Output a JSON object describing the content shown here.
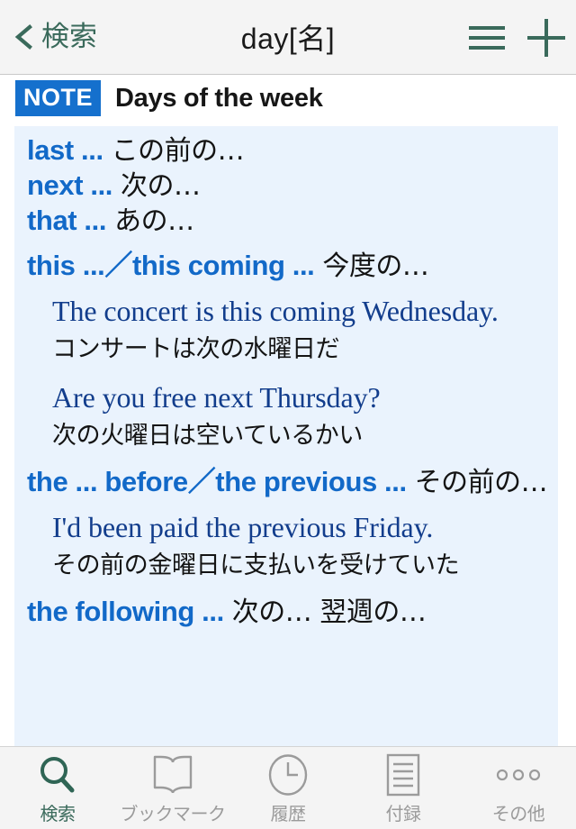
{
  "header": {
    "back_label": "検索",
    "back_icon": "chevron-left-icon",
    "title": "day[名]",
    "menu_icon": "hamburger-menu-icon",
    "add_icon": "plus-icon",
    "accent_color": "#3a6a5b"
  },
  "note": {
    "badge": "NOTE",
    "badge_color": "#1570cd",
    "title": "Days of the week"
  },
  "panel": {
    "background_color": "#eaf3fd",
    "headword_color": "#1269c8",
    "example_color": "#123d8c",
    "entries": [
      {
        "headword": "last ...",
        "gloss": "この前の…"
      },
      {
        "headword": "next ...",
        "gloss": "次の…"
      },
      {
        "headword": "that ...",
        "gloss": "あの…"
      },
      {
        "headword": "this ...／this coming ...",
        "gloss": "今度の…"
      }
    ],
    "examples_1": [
      {
        "en": "The concert is this coming Wednesday.",
        "ja": "コンサートは次の水曜日だ"
      },
      {
        "en": "Are you free next Thursday?",
        "ja": "次の火曜日は空いているかい"
      }
    ],
    "entry_before": {
      "headword": "the ... before／the previous ...",
      "gloss": "その前の…"
    },
    "examples_2": [
      {
        "en": "I'd been paid the previous Friday.",
        "ja": "その前の金曜日に支払いを受けていた"
      }
    ],
    "entry_following": {
      "headword": "the following ...",
      "gloss": "次の… 翌週の…"
    }
  },
  "tabbar": {
    "tabs": [
      {
        "label": "検索",
        "icon": "search-icon",
        "active": true
      },
      {
        "label": "ブックマーク",
        "icon": "book-icon",
        "active": false
      },
      {
        "label": "履歴",
        "icon": "clock-icon",
        "active": false
      },
      {
        "label": "付録",
        "icon": "document-lines-icon",
        "active": false
      },
      {
        "label": "その他",
        "icon": "ellipsis-icon",
        "active": false
      }
    ]
  }
}
